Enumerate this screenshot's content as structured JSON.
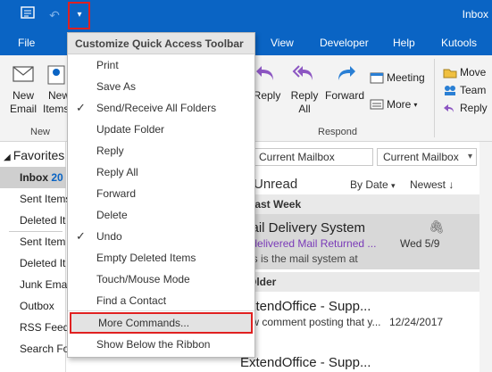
{
  "window": {
    "title": "Inbox"
  },
  "tabs": [
    "File",
    "View",
    "Developer",
    "Help",
    "Kutools"
  ],
  "ribbon": {
    "new_group": {
      "new_email": [
        "New",
        "Email"
      ],
      "new_items": [
        "New",
        "Items"
      ],
      "label": "New"
    },
    "respond": {
      "reply": "Reply",
      "reply_all": [
        "Reply",
        "All"
      ],
      "forward": "Forward",
      "meeting": "Meeting",
      "more": "More",
      "label": "Respond"
    },
    "quick": {
      "move": "Move",
      "team": "Team",
      "reply": "Reply"
    }
  },
  "folders": {
    "favorites": "Favorites",
    "inbox": "Inbox",
    "inbox_count": "20",
    "fav_items": [
      "Sent Items",
      "Deleted It"
    ],
    "items": [
      "Sent Item",
      "Deleted It",
      "Junk Ema",
      "Outbox",
      "RSS Feeds",
      "Search Fo"
    ]
  },
  "mail": {
    "search_placeholder": "Current Mailbox",
    "scope": "Current Mailbox",
    "unread_tab": "Unread",
    "sort_by": "By Date",
    "sort_order": "Newest",
    "sections": [
      "Last Week",
      "Older"
    ],
    "items": [
      {
        "sender": "Mail Delivery System",
        "subject": "Undelivered Mail Returned ...",
        "preview": "This is the mail system at",
        "date": "Wed 5/9",
        "attachment": true
      },
      {
        "sender": "ExtendOffice - Supp...",
        "subject": "New comment posting that y...",
        "preview": "",
        "date": "12/24/2017",
        "attachment": false
      },
      {
        "sender": "ExtendOffice - Supp...",
        "subject": "",
        "preview": "",
        "date": "",
        "attachment": false
      }
    ]
  },
  "menu": {
    "header": "Customize Quick Access Toolbar",
    "items": [
      {
        "label": "Print",
        "checked": false
      },
      {
        "label": "Save As",
        "checked": false
      },
      {
        "label": "Send/Receive All Folders",
        "checked": true
      },
      {
        "label": "Update Folder",
        "checked": false
      },
      {
        "label": "Reply",
        "checked": false
      },
      {
        "label": "Reply All",
        "checked": false
      },
      {
        "label": "Forward",
        "checked": false
      },
      {
        "label": "Delete",
        "checked": false
      },
      {
        "label": "Undo",
        "checked": true
      },
      {
        "label": "Empty Deleted Items",
        "checked": false
      },
      {
        "label": "Touch/Mouse Mode",
        "checked": false
      },
      {
        "label": "Find a Contact",
        "checked": false
      },
      {
        "label": "More Commands...",
        "checked": false
      },
      {
        "label": "Show Below the Ribbon",
        "checked": false
      }
    ]
  },
  "colors": {
    "accent": "#0a64c4",
    "highlight_border": "#e02020"
  }
}
